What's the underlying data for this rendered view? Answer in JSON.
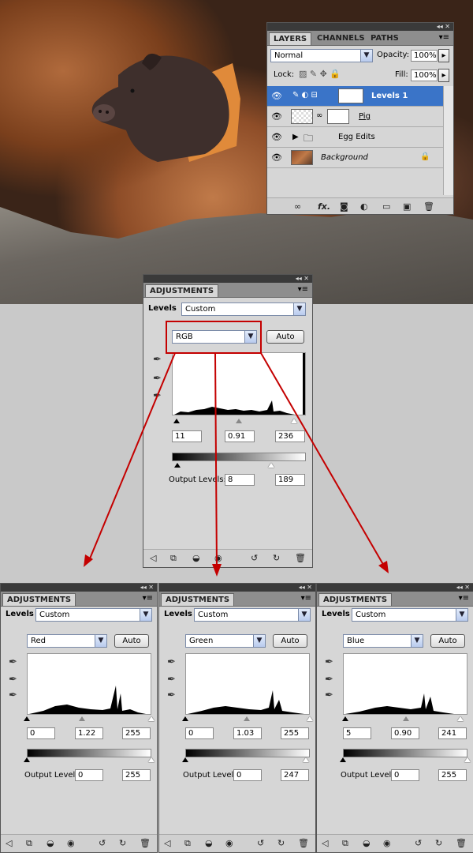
{
  "layers_panel": {
    "tabs": [
      "LAYERS",
      "CHANNELS",
      "PATHS"
    ],
    "blend_mode": "Normal",
    "opacity_label": "Opacity:",
    "opacity": "100%",
    "lock_label": "Lock:",
    "fill_label": "Fill:",
    "fill": "100%",
    "layers": [
      {
        "name": "Levels 1",
        "selected": true
      },
      {
        "name": "Pig",
        "selected": false
      },
      {
        "name": "Egg Edits",
        "selected": false
      },
      {
        "name": "Background",
        "selected": false
      }
    ]
  },
  "main_adjust": {
    "tab": "ADJUSTMENTS",
    "preset_label": "Levels",
    "preset": "Custom",
    "channel": "RGB",
    "auto": "Auto",
    "input_black": "11",
    "input_gamma": "0.91",
    "input_white": "236",
    "output_label": "Output Levels:",
    "output_black": "8",
    "output_white": "189"
  },
  "small_panels": [
    {
      "tab": "ADJUSTMENTS",
      "preset_label": "Levels",
      "preset": "Custom",
      "channel": "Red",
      "auto": "Auto",
      "input_black": "0",
      "input_gamma": "1.22",
      "input_white": "255",
      "output_label": "Output Levels:",
      "output_black": "0",
      "output_white": "255"
    },
    {
      "tab": "ADJUSTMENTS",
      "preset_label": "Levels",
      "preset": "Custom",
      "channel": "Green",
      "auto": "Auto",
      "input_black": "0",
      "input_gamma": "1.03",
      "input_white": "255",
      "output_label": "Output Levels:",
      "output_black": "0",
      "output_white": "247"
    },
    {
      "tab": "ADJUSTMENTS",
      "preset_label": "Levels",
      "preset": "Custom",
      "channel": "Blue",
      "auto": "Auto",
      "input_black": "5",
      "input_gamma": "0.90",
      "input_white": "241",
      "output_label": "Output Levels:",
      "output_black": "0",
      "output_white": "255"
    }
  ],
  "colors": {
    "highlight": "#c40000",
    "selected_layer": "#3a74c8"
  }
}
